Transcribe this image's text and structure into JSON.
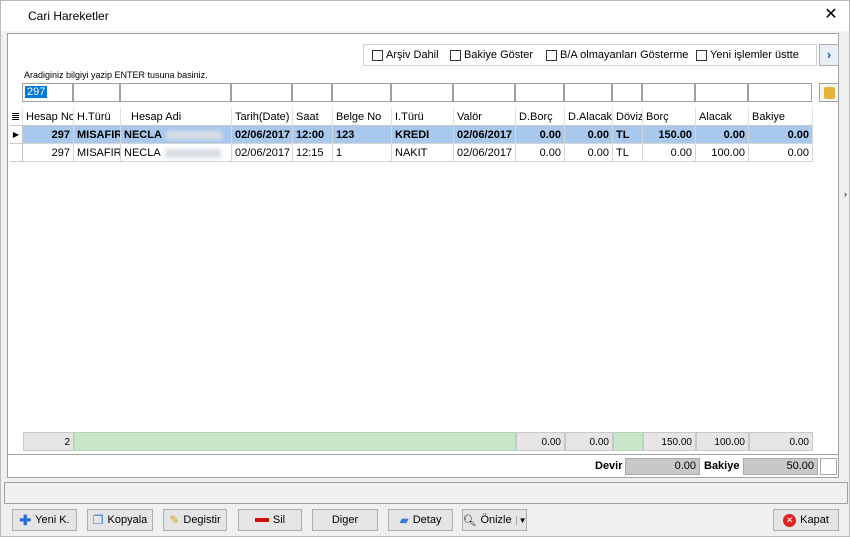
{
  "window": {
    "title": "Cari Hareketler",
    "close_glyph": "✕"
  },
  "checkboxes": [
    {
      "label": "Arşiv Dahil",
      "checked": false
    },
    {
      "label": "Bakiye Göster",
      "checked": false
    },
    {
      "label": "B/A olmayanları Gösterme",
      "checked": false
    },
    {
      "label": "Yeni işlemler üstte",
      "checked": false
    }
  ],
  "nav_glyph": "›",
  "hint": "Aradiginiz bilgiyi yazip ENTER tusuna basiniz.",
  "filter_value": "297",
  "columns": [
    "Hesap No",
    "H.Türü",
    "Hesap Adi",
    "Tarih(Date)",
    "Saat",
    "Belge No",
    "I.Türü",
    "Valör",
    "D.Borç",
    "D.Alacak",
    "Döviz",
    "Borç",
    "Alacak",
    "Bakiye"
  ],
  "rows": [
    {
      "selected": true,
      "cells": [
        "297",
        "MISAFIR",
        "NECLA",
        "02/06/2017",
        "12:00",
        "123",
        "KREDI",
        "02/06/2017",
        "0.00",
        "0.00",
        "TL",
        "150.00",
        "0.00",
        "0.00"
      ]
    },
    {
      "selected": false,
      "cells": [
        "297",
        "MISAFIR",
        "NECLA",
        "02/06/2017",
        "12:15",
        "1",
        "NAKIT",
        "02/06/2017",
        "0.00",
        "0.00",
        "TL",
        "0.00",
        "100.00",
        "0.00"
      ]
    }
  ],
  "summary": {
    "count": "2",
    "d_borc": "0.00",
    "d_alacak": "0.00",
    "borc": "150.00",
    "alacak": "100.00",
    "bakiye": "0.00"
  },
  "devir": {
    "label": "Devir",
    "value": "0.00",
    "bakiye_label": "Bakiye",
    "bakiye_value": "50.00"
  },
  "buttons": {
    "yeni": "Yeni K.",
    "kopyala": "Kopyala",
    "degistir": "Degistir",
    "sil": "Sil",
    "diger": "Diger",
    "detay": "Detay",
    "onizle": "Önizle",
    "kapat": "Kapat"
  },
  "colors": {
    "selection": "#a8c8ee",
    "summary_green": "#c8e6c9",
    "accent": "#0078d7"
  }
}
